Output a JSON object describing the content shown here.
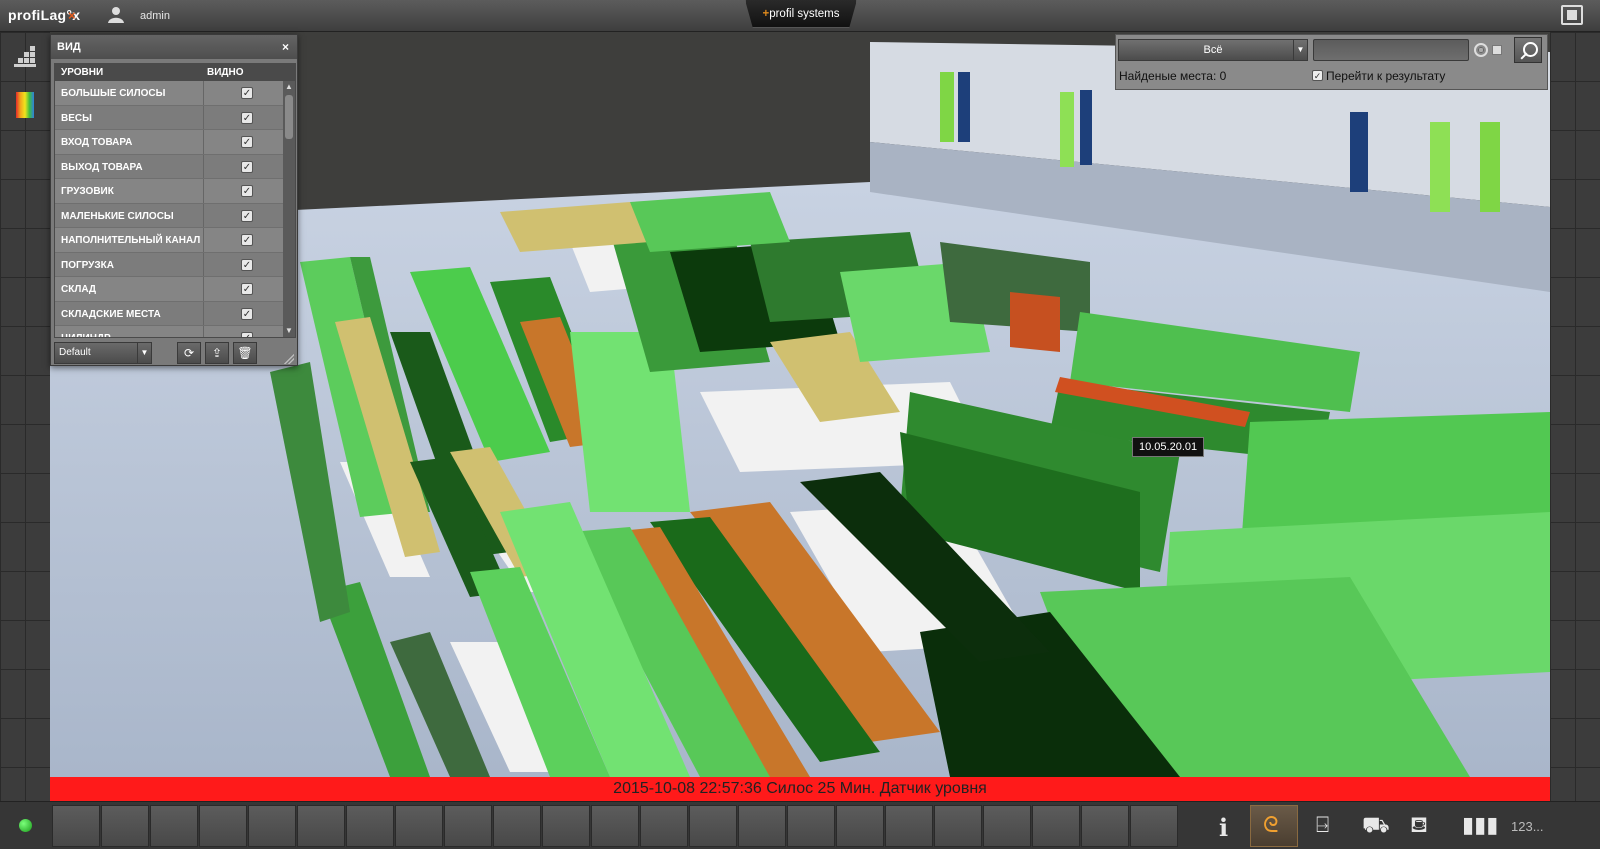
{
  "header": {
    "brand": "profiLag°x",
    "user": "admin",
    "vendor_plus": "+",
    "vendor_name": "profil systems"
  },
  "view_panel": {
    "title": "ВИД",
    "close": "×",
    "col_levels": "УРОВНИ",
    "col_visible": "ВИДНО",
    "rows": [
      {
        "name": "БОЛЬШЫЕ СИЛОСЫ",
        "checked": true
      },
      {
        "name": "ВЕСЫ",
        "checked": true
      },
      {
        "name": "ВХОД ТОВАРА",
        "checked": true
      },
      {
        "name": "ВЫХОД ТОВАРА",
        "checked": true
      },
      {
        "name": "ГРУЗОВИК",
        "checked": true
      },
      {
        "name": "МАЛЕНЬКИЕ СИЛОСЫ",
        "checked": true
      },
      {
        "name": "НАПОЛНИТЕЛЬНЫЙ КАНАЛ",
        "checked": true
      },
      {
        "name": "ПОГРУЗКА",
        "checked": true
      },
      {
        "name": "СКЛАД",
        "checked": true
      },
      {
        "name": "СКЛАДСКИЕ МЕСТА",
        "checked": true
      },
      {
        "name": "ЦИЛИНДР",
        "checked": true
      }
    ],
    "preset": "Default"
  },
  "search": {
    "scope": "Всё",
    "query": "",
    "found_label": "Найденые места: 0",
    "goto_label": "Перейти к результату"
  },
  "tooltip": "10.05.20.01",
  "alarm": "2015-10-08 22:57:36 Силос 25 Мин. Датчик уровня",
  "bottom": {
    "counter": "123..."
  },
  "colors": {
    "alarm": "#ff1a1a",
    "accent": "#e08a1c",
    "status_ok": "#1a9a1a"
  }
}
